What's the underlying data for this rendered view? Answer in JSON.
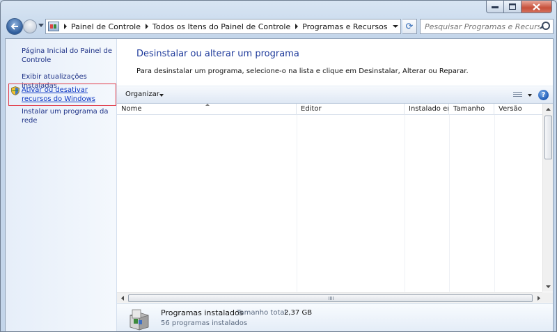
{
  "window": {
    "buttons": [
      "minimize",
      "maximize",
      "close"
    ]
  },
  "address": {
    "crumbs": [
      "Painel de Controle",
      "Todos os Itens do Painel de Controle",
      "Programas e Recursos"
    ]
  },
  "search": {
    "placeholder": "Pesquisar Programas e Recursos"
  },
  "sidebar": {
    "items": [
      {
        "label": "Página Inicial do Painel de Controle"
      },
      {
        "label": "Exibir atualizações instaladas"
      },
      {
        "label": "Ativar ou desativar recursos do Windows",
        "icon": "shield-icon"
      },
      {
        "label": "Instalar um programa da rede"
      }
    ]
  },
  "main": {
    "title": "Desinstalar ou alterar um programa",
    "description": "Para desinstalar um programa, selecione-o na lista e clique em Desinstalar, Alterar ou Reparar."
  },
  "toolbar": {
    "organize_label": "Organizar",
    "help_label": "?"
  },
  "list": {
    "columns": [
      "Nome",
      "Editor",
      "Instalado em",
      "Tamanho",
      "Versão"
    ],
    "rows": []
  },
  "details": {
    "title": "Programas instalados",
    "size_label": "Tamanho total:",
    "size_value": "2,37 GB",
    "count": "56 programas instalados"
  },
  "colors": {
    "link": "#1e3287",
    "title_blue": "#1e3a9b",
    "highlight_border": "#e13b48"
  }
}
